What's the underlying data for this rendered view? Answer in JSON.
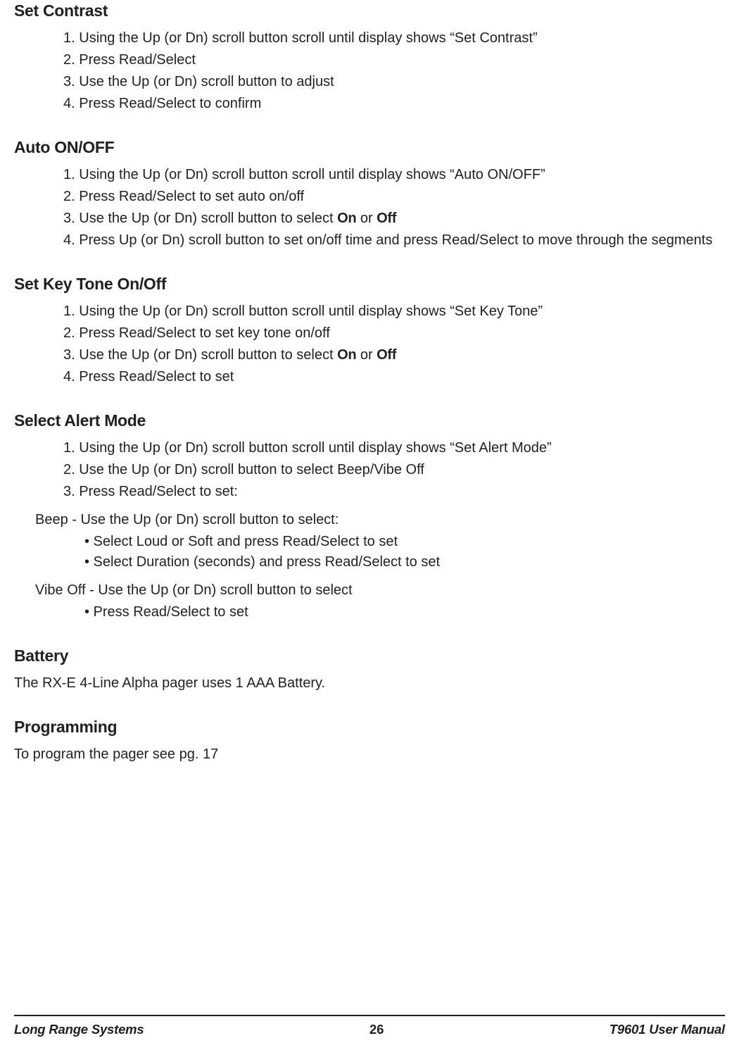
{
  "sections": {
    "setContrast": {
      "heading": "Set Contrast",
      "steps": [
        "Using the Up (or Dn) scroll button scroll until display shows “Set Contrast”",
        "Press Read/Select",
        "Use the Up (or Dn) scroll button to adjust",
        "Press Read/Select to confirm"
      ]
    },
    "autoOnOff": {
      "heading": "Auto ON/OFF",
      "step1": "Using the Up (or Dn) scroll button scroll until display shows “Auto ON/OFF”",
      "step2": "Press Read/Select to set auto on/off",
      "step3_pre": "Use the Up (or Dn) scroll button to select ",
      "step3_on": "On",
      "step3_or": " or ",
      "step3_off": "Off",
      "step4": "Press Up (or Dn) scroll button to set on/off time and press Read/Select to move through the seg­ments"
    },
    "keyTone": {
      "heading": "Set Key Tone On/Off",
      "step1": "Using the Up (or Dn) scroll button scroll until display shows “Set Key Tone”",
      "step2": "Press Read/Select to set key tone on/off",
      "step3_pre": "Use the Up (or Dn) scroll button to select ",
      "step3_on": "On",
      "step3_or": " or ",
      "step3_off": "Off",
      "step4": "Press Read/Select to set"
    },
    "alert": {
      "heading": "Select Alert Mode",
      "steps": [
        "Using the Up (or Dn) scroll button scroll until display shows “Set Alert Mode”",
        "Use the Up (or Dn) scroll button to select Beep/Vibe Off",
        "Press Read/Select to set:"
      ],
      "beep_intro": "Beep - Use the Up (or Dn) scroll button to select:",
      "beep_b1": "• Select Loud or Soft and press Read/Select to set",
      "beep_b2": "• Select Duration (seconds) and press Read/Select to set",
      "vibe_intro": "Vibe Off - Use the Up (or Dn) scroll button to select",
      "vibe_b1": "• Press Read/Select to set"
    },
    "battery": {
      "heading": "Battery",
      "text": "The RX-E 4-Line Alpha pager uses 1 AAA Battery."
    },
    "programming": {
      "heading": "Programming",
      "text": "To program the pager see pg. 17"
    }
  },
  "footer": {
    "left": "Long Range Systems",
    "center": "26",
    "right": "T9601 User Manual"
  }
}
